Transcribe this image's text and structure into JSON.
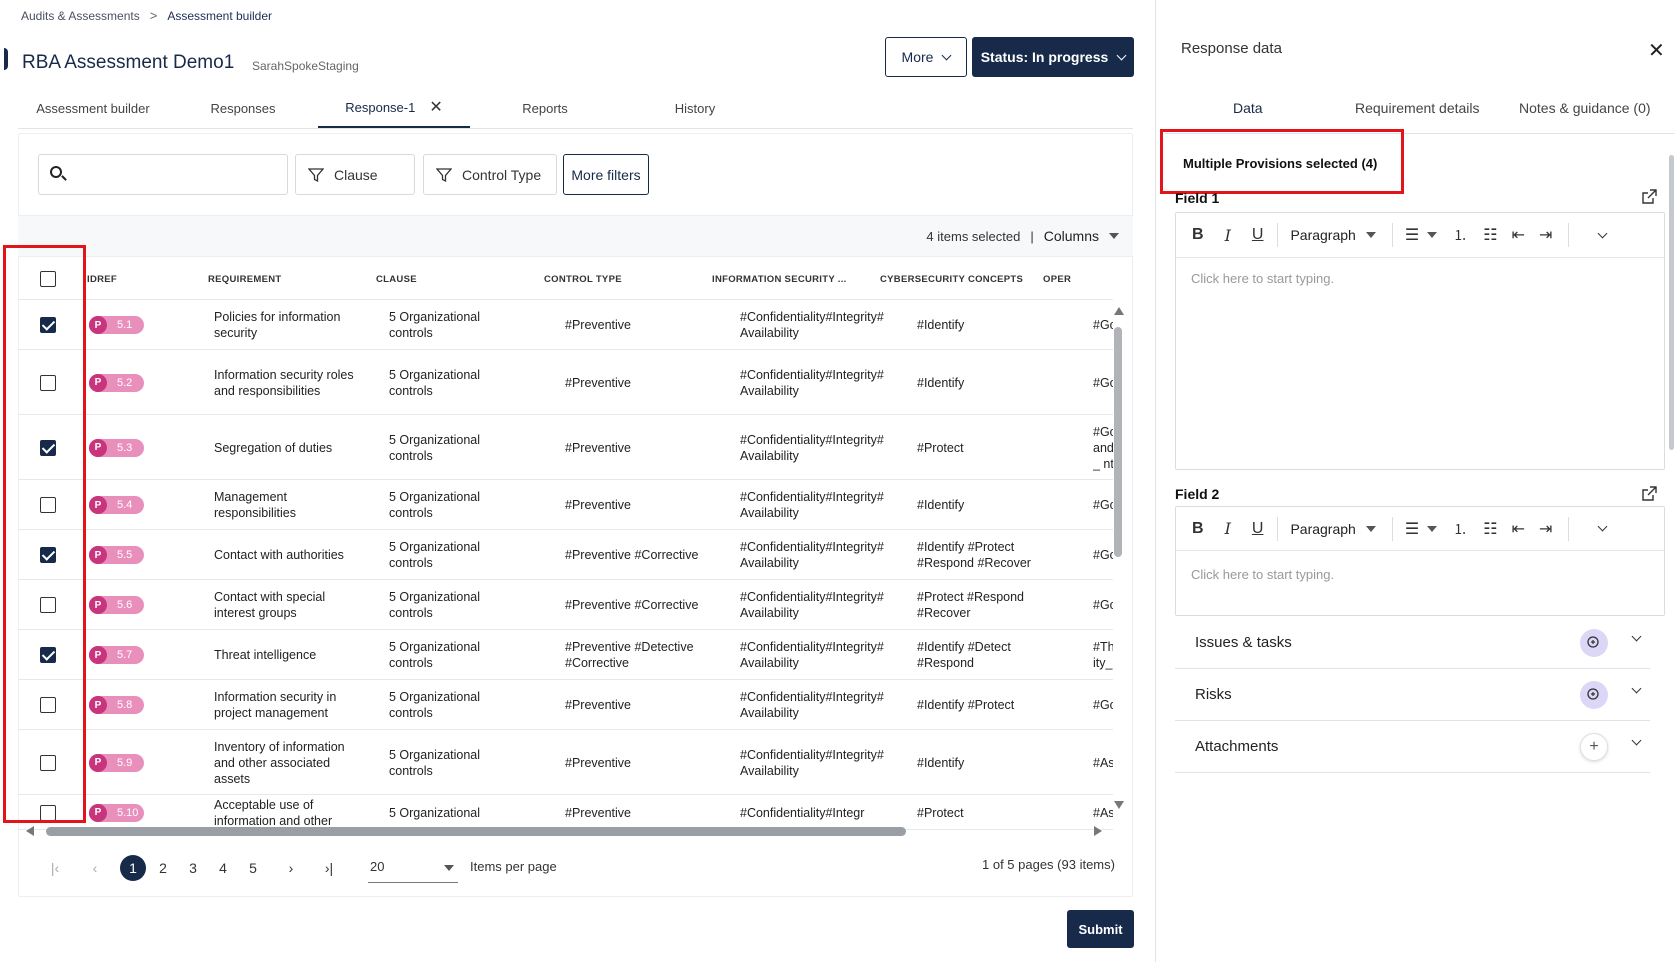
{
  "breadcrumb": {
    "parent": "Audits & Assessments",
    "separator": ">",
    "current": "Assessment builder"
  },
  "header": {
    "title": "RBA Assessment Demo1",
    "subtitle": "SarahSpokeStaging",
    "more_label": "More",
    "status_label": "Status: In progress"
  },
  "tabs": [
    {
      "label": "Assessment builder"
    },
    {
      "label": "Responses"
    },
    {
      "label": "Response-1",
      "closable": true
    },
    {
      "label": "Reports"
    },
    {
      "label": "History"
    }
  ],
  "filters": {
    "search_placeholder": "",
    "clause_label": "Clause",
    "control_type_label": "Control Type",
    "more_filters_label": "More filters"
  },
  "selection": {
    "info": "4 items selected",
    "separator": "|",
    "columns_label": "Columns"
  },
  "table": {
    "headers": [
      "IDREF",
      "REQUIREMENT",
      "CLAUSE",
      "CONTROL TYPE",
      "INFORMATION SECURITY ...",
      "CYBERSECURITY CONCEPTS",
      "OPER"
    ],
    "pill_letter": "P",
    "rows": [
      {
        "checked": true,
        "id": "5.1",
        "req": "Policies for information security",
        "clause": "5 Organizational controls",
        "ctype": "#Preventive",
        "infosec": "#Confidentiality#Integrity#Availability",
        "cyber": "#Identify",
        "oper": "#Go"
      },
      {
        "checked": false,
        "id": "5.2",
        "req": "Information security roles and responsibilities",
        "clause": "5 Organizational controls",
        "ctype": "#Preventive",
        "infosec": "#Confidentiality#Integrity#Availability",
        "cyber": "#Identify",
        "oper": "#Go"
      },
      {
        "checked": true,
        "id": "5.3",
        "req": "Segregation of duties",
        "clause": "5 Organizational controls",
        "ctype": "#Preventive",
        "infosec": "#Confidentiality#Integrity#Availability",
        "cyber": "#Protect",
        "oper": "#Go and_ nt"
      },
      {
        "checked": false,
        "id": "5.4",
        "req": "Management responsibilities",
        "clause": "5 Organizational controls",
        "ctype": "#Preventive",
        "infosec": "#Confidentiality#Integrity#Availability",
        "cyber": "#Identify",
        "oper": "#Go"
      },
      {
        "checked": true,
        "id": "5.5",
        "req": "Contact with authorities",
        "clause": "5 Organizational controls",
        "ctype": "#Preventive #Corrective",
        "infosec": "#Confidentiality#Integrity#Availability",
        "cyber": "#Identify #Protect #Respond #Recover",
        "oper": "#Go"
      },
      {
        "checked": false,
        "id": "5.6",
        "req": "Contact with special interest groups",
        "clause": "5 Organizational controls",
        "ctype": "#Preventive #Corrective",
        "infosec": "#Confidentiality#Integrity#Availability",
        "cyber": "#Protect #Respond #Recover",
        "oper": "#Go"
      },
      {
        "checked": true,
        "id": "5.7",
        "req": "Threat intelligence",
        "clause": "5 Organizational controls",
        "ctype": "#Preventive #Detective #Corrective",
        "infosec": "#Confidentiality#Integrity#Availability",
        "cyber": "#Identify #Detect #Respond",
        "oper": "#Th ity_i"
      },
      {
        "checked": false,
        "id": "5.8",
        "req": "Information security in project management",
        "clause": "5 Organizational controls",
        "ctype": "#Preventive",
        "infosec": "#Confidentiality#Integrity#Availability",
        "cyber": "#Identify #Protect",
        "oper": "#Go"
      },
      {
        "checked": false,
        "id": "5.9",
        "req": "Inventory of information and other associated assets",
        "clause": "5 Organizational controls",
        "ctype": "#Preventive",
        "infosec": "#Confidentiality#Integrity#Availability",
        "cyber": "#Identify",
        "oper": "#As"
      },
      {
        "checked": false,
        "id": "5.10",
        "req": "Acceptable use of information and other",
        "clause": "5 Organizational",
        "ctype": "#Preventive",
        "infosec": "#Confidentiality#Integr",
        "cyber": "#Protect",
        "oper": "#As"
      }
    ]
  },
  "pagination": {
    "pages": [
      "1",
      "2",
      "3",
      "4",
      "5"
    ],
    "current": "1",
    "per_page": "20",
    "per_page_label": "Items per page",
    "info": "1 of 5 pages (93 items)"
  },
  "submit_label": "Submit",
  "panel": {
    "title": "Response data",
    "tabs": [
      "Data",
      "Requirement details",
      "Notes & guidance (0)"
    ],
    "multi_title": "Multiple Provisions selected (4)",
    "fields": [
      {
        "label": "Field 1",
        "placeholder": "Click here to start typing."
      },
      {
        "label": "Field 2",
        "placeholder": "Click here to start typing."
      }
    ],
    "toolbar": {
      "bold": "B",
      "italic": "I",
      "underline": "U",
      "paragraph": "Paragraph"
    },
    "sections": [
      "Issues & tasks",
      "Risks",
      "Attachments"
    ]
  },
  "colors": {
    "navy": "#172a4a",
    "pill": "#e98fbb",
    "pill_dark": "#c8357c",
    "highlight_red": "#e0161b"
  }
}
